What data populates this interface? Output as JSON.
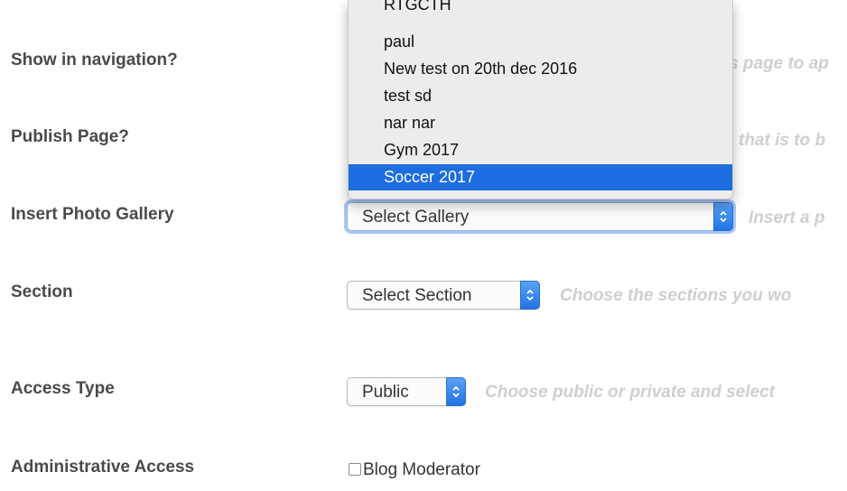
{
  "form": {
    "rows": [
      {
        "label": "Show in navigation?",
        "help": "s page to ap"
      },
      {
        "label": "Publish Page?",
        "help": "that is to b"
      },
      {
        "label": "Insert Photo Gallery",
        "help": "Insert a p"
      },
      {
        "label": "Section",
        "help": "Choose the sections you wo"
      },
      {
        "label": "Access Type",
        "help": "Choose public or private and select"
      },
      {
        "label": "Administrative Access"
      }
    ],
    "gallery_select": {
      "value": "Select Gallery"
    },
    "section_select": {
      "value": "Select Section"
    },
    "access_select": {
      "value": "Public"
    },
    "admin_checkbox": {
      "label": "Blog Moderator",
      "checked": false
    }
  },
  "gallery_dropdown": {
    "options": [
      "RTGCTH",
      "paul",
      "New test on 20th dec 2016",
      "test sd",
      "nar nar",
      "Gym 2017",
      "Soccer 2017"
    ],
    "highlighted": "Soccer 2017"
  },
  "colors": {
    "label": "#4a4a4a",
    "help": "#cfcfcf",
    "highlight": "#1d6de0",
    "stepper": "#2174e3"
  }
}
